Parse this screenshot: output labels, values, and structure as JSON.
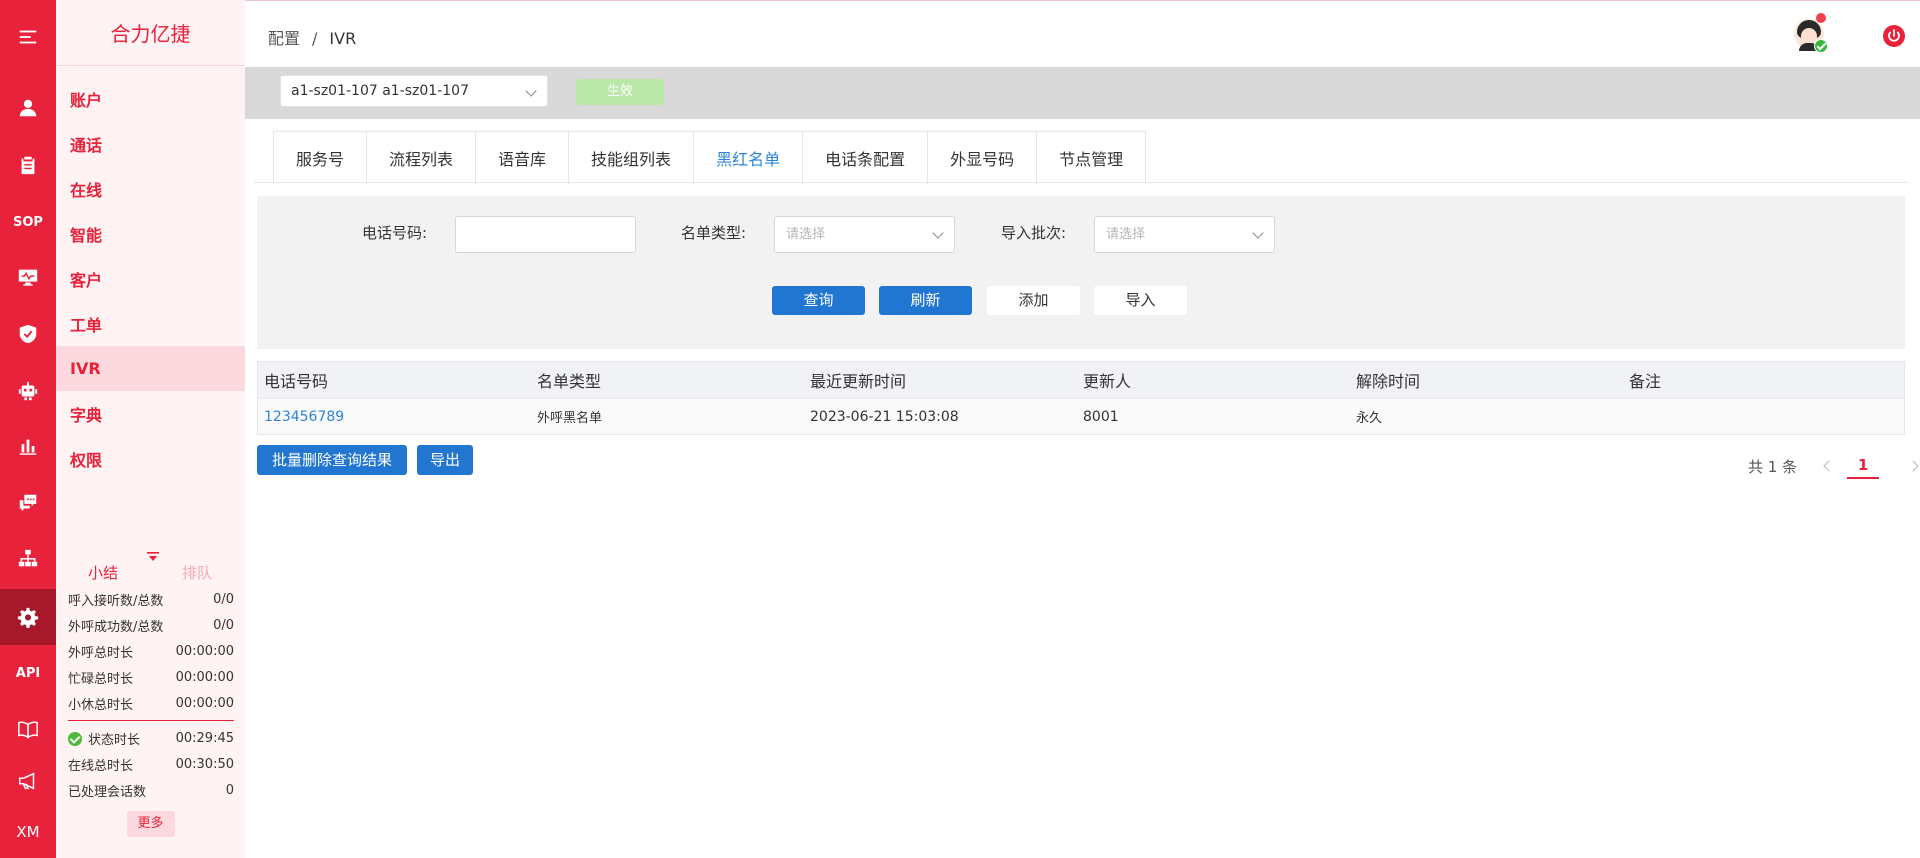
{
  "app": {
    "brand": "合力亿捷"
  },
  "rail": {
    "items": [
      {
        "icon": "menu-icon"
      },
      {
        "icon": "person-icon"
      },
      {
        "icon": "clipboard-icon"
      },
      {
        "icon": "sop-icon",
        "label": "SOP"
      },
      {
        "icon": "monitor-icon"
      },
      {
        "icon": "shield-icon"
      },
      {
        "icon": "robot-icon"
      },
      {
        "icon": "bar-chart-icon"
      },
      {
        "icon": "chat-icon"
      },
      {
        "icon": "org-tree-icon"
      },
      {
        "icon": "gear-icon"
      },
      {
        "icon": "api-icon",
        "label": "API"
      },
      {
        "icon": "book-icon"
      },
      {
        "icon": "megaphone-icon"
      },
      {
        "icon": "xm-icon",
        "label": "XM"
      }
    ],
    "active_color": "#a8182b",
    "color": "#e8223b"
  },
  "nav": {
    "items": [
      {
        "label": "账户"
      },
      {
        "label": "通话"
      },
      {
        "label": "在线"
      },
      {
        "label": "智能"
      },
      {
        "label": "客户"
      },
      {
        "label": "工单"
      },
      {
        "label": "IVR"
      },
      {
        "label": "字典"
      },
      {
        "label": "权限"
      }
    ],
    "active": "IVR"
  },
  "summary": {
    "tab_summary": "小结",
    "tab_queue": "排队",
    "rows": [
      {
        "label": "呼入接听数/总数",
        "value": "0/0"
      },
      {
        "label": "外呼成功数/总数",
        "value": "0/0"
      },
      {
        "label": "外呼总时长",
        "value": "00:00:00"
      },
      {
        "label": "忙碌总时长",
        "value": "00:00:00"
      },
      {
        "label": "小休总时长",
        "value": "00:00:00"
      }
    ],
    "rows2": [
      {
        "label": "状态时长",
        "value": "00:29:45"
      },
      {
        "label": "在线总时长",
        "value": "00:30:50"
      },
      {
        "label": "已处理会话数",
        "value": "0"
      }
    ],
    "more": "更多"
  },
  "header": {
    "breadcrumb": [
      "配置",
      "IVR"
    ],
    "breadcrumb_sep": "/"
  },
  "toolbar": {
    "select_value": "a1-sz01-107 a1-sz01-107",
    "apply_label": "生效"
  },
  "tabs": [
    {
      "label": "服务号"
    },
    {
      "label": "流程列表"
    },
    {
      "label": "语音库"
    },
    {
      "label": "技能组列表"
    },
    {
      "label": "黑红名单"
    },
    {
      "label": "电话条配置"
    },
    {
      "label": "外显号码"
    },
    {
      "label": "节点管理"
    }
  ],
  "active_tab": "黑红名单",
  "filter": {
    "phone_label": "电话号码:",
    "phone_value": "",
    "type_label": "名单类型:",
    "type_placeholder": "请选择",
    "batch_label": "导入批次:",
    "batch_placeholder": "请选择",
    "query": "查询",
    "refresh": "刷新",
    "add": "添加",
    "import": "导入"
  },
  "table": {
    "columns": [
      "电话号码",
      "名单类型",
      "最近更新时间",
      "更新人",
      "解除时间",
      "备注"
    ],
    "rows": [
      [
        "123456789",
        "外呼黑名单",
        "2023-06-21 15:03:08",
        "8001",
        "永久",
        ""
      ]
    ]
  },
  "actions": {
    "bulk_delete": "批量删除查询结果",
    "export": "导出"
  },
  "pager": {
    "total": "共 1 条",
    "current": "1"
  }
}
